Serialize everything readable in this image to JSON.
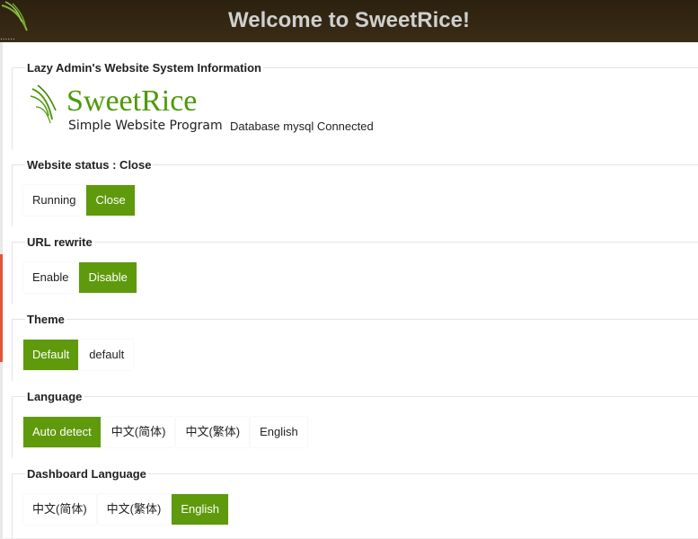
{
  "header": {
    "title": "Welcome to SweetRice!",
    "dots": "......"
  },
  "system_info": {
    "legend": "Lazy Admin's Website System Information",
    "logo_name": "SweetRice",
    "logo_tagline": "Simple Website Program",
    "db_status": "Database mysql Connected"
  },
  "website_status": {
    "legend": "Website status : Close",
    "options": [
      "Running",
      "Close"
    ],
    "active": "Close"
  },
  "url_rewrite": {
    "legend": "URL rewrite",
    "options": [
      "Enable",
      "Disable"
    ],
    "active": "Disable"
  },
  "theme": {
    "legend": "Theme",
    "options": [
      "Default",
      "default"
    ],
    "active": "Default"
  },
  "language": {
    "legend": "Language",
    "options": [
      "Auto detect",
      "中文(简体)",
      "中文(繁体)",
      "English"
    ],
    "active": "Auto detect"
  },
  "dashboard_language": {
    "legend": "Dashboard Language",
    "options": [
      "中文(简体)",
      "中文(繁体)",
      "English"
    ],
    "active": "English"
  },
  "colors": {
    "header_bg": "#2c210f",
    "accent_green": "#5f9a0c",
    "side_red": "#e0553a"
  },
  "icons": {
    "corner": "rice-leaf-icon",
    "logo": "sweetrice-logo"
  }
}
